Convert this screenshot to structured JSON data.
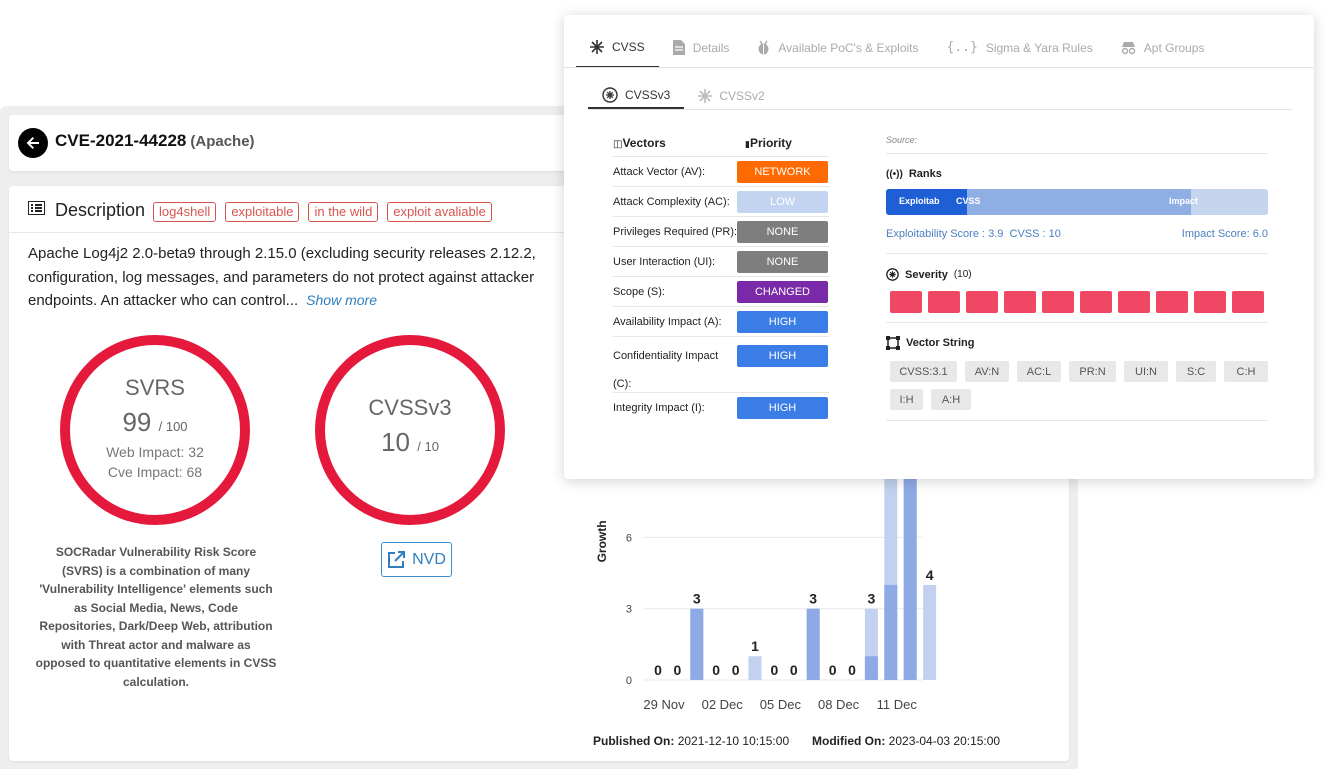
{
  "cve": {
    "id": "CVE-2021-44228",
    "vendor": "(Apache)"
  },
  "description": {
    "title": "Description",
    "tags": [
      "log4shell",
      "exploitable",
      "in the wild",
      "exploit avaliable"
    ],
    "lines": [
      "Apache Log4j2 2.0-beta9 through 2.15.0 (excluding security releases 2.12.2,",
      "configuration, log messages, and parameters do not protect against attacker",
      "endpoints. An attacker who can control..."
    ],
    "show_more": "Show more"
  },
  "svrs": {
    "title": "SVRS",
    "score": "99",
    "max": "/ 100",
    "web_impact": "Web Impact: 32",
    "cve_impact": "Cve Impact: 68",
    "caption_lines": [
      "SOCRadar Vulnerability Risk Score",
      "(SVRS) is a combination of many",
      "'Vulnerability Intelligence' elements such",
      "as Social Media, News, Code",
      "Repositories, Dark/Deep Web, attribution",
      "with Threat actor and malware as",
      "opposed to quantitative elements in CVSS",
      "calculation."
    ]
  },
  "cvss_ring": {
    "title": "CVSSv3",
    "score": "10",
    "max": "/ 10",
    "nvd_label": "NVD"
  },
  "chart_data": {
    "type": "bar",
    "ylabel": "Growth",
    "yticks": [
      "0",
      "3",
      "6"
    ],
    "ylim": [
      0,
      8.5
    ],
    "xtick_labels": [
      "29 Nov",
      "02 Dec",
      "05 Dec",
      "08 Dec",
      "11 Dec"
    ],
    "values": [
      0,
      0,
      3,
      0,
      0,
      1,
      0,
      0,
      3,
      0,
      0,
      3,
      8.5,
      8.5,
      4
    ],
    "labels": [
      "0",
      "0",
      "3",
      "0",
      "0",
      "1",
      "0",
      "0",
      "3",
      "0",
      "0",
      "3",
      "",
      "",
      "4"
    ],
    "dark_part": [
      0,
      0,
      3,
      0,
      0,
      0,
      0,
      0,
      3,
      0,
      0,
      1,
      4,
      8.5,
      0
    ]
  },
  "meta": {
    "published_label": "Published On:",
    "published": "2021-12-10 10:15:00",
    "modified_label": "Modified On:",
    "modified": "2023-04-03 20:15:00"
  },
  "panel": {
    "tabs": [
      "CVSS",
      "Details",
      "Available PoC's & Exploits",
      "Sigma & Yara Rules",
      "Apt Groups"
    ],
    "subtabs": [
      "CVSSv3",
      "CVSSv2"
    ],
    "vectors_header": "Vectors",
    "priority_header": "Priority",
    "vectors": [
      {
        "name": "Attack Vector (AV):",
        "value": "NETWORK",
        "color": "#ff6a00"
      },
      {
        "name": "Attack Complexity (AC):",
        "value": "LOW",
        "color": "#c3d4f0"
      },
      {
        "name": "Privileges Required (PR):",
        "value": "NONE",
        "color": "#7e7e7e"
      },
      {
        "name": "User Interaction (UI):",
        "value": "NONE",
        "color": "#7e7e7e"
      },
      {
        "name": "Scope (S):",
        "value": "CHANGED",
        "color": "#7a2aa8"
      },
      {
        "name": "Availability Impact (A):",
        "value": "HIGH",
        "color": "#3a7de6"
      },
      {
        "name": "Confidentiality Impact (C):",
        "value": "HIGH",
        "color": "#3a7de6"
      },
      {
        "name": "Integrity Impact (I):",
        "value": "HIGH",
        "color": "#3a7de6"
      }
    ],
    "source_label": "Source:",
    "ranks": {
      "title": "Ranks",
      "bar_exploitab": "Exploitab",
      "bar_cvss": "CVSS",
      "bar_impact": "Impact",
      "exploitability": "Exploitability Score : 3.9",
      "cvss": "CVSS : 10",
      "impact": "Impact Score: 6.0",
      "exploitability_value": 3.9,
      "impact_value": 6.0,
      "max": 10
    },
    "severity": {
      "title": "Severity",
      "count": "(10)",
      "cells": 10
    },
    "vector_string": {
      "title": "Vector String",
      "chips": [
        "CVSS:3.1",
        "AV:N",
        "AC:L",
        "PR:N",
        "UI:N",
        "S:C",
        "C:H",
        "I:H",
        "A:H"
      ]
    }
  }
}
